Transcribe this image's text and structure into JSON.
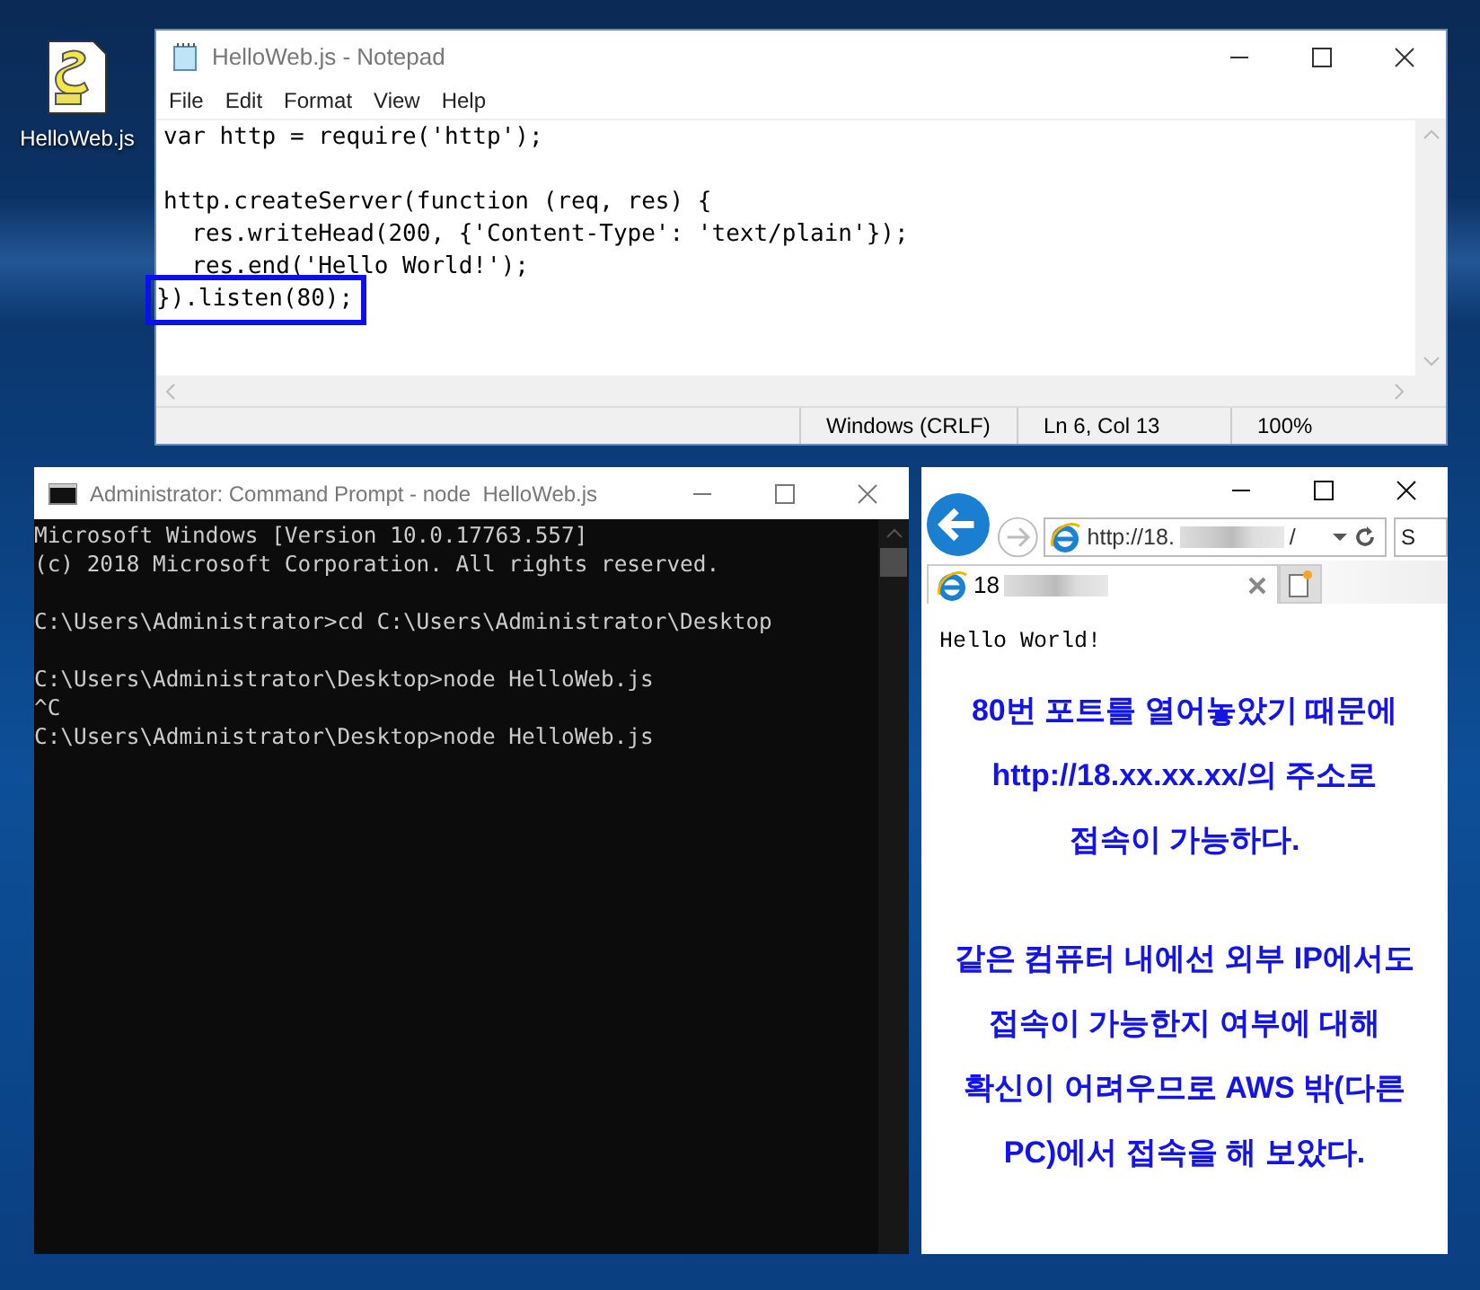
{
  "desktop_icon": {
    "label": "HelloWeb.js"
  },
  "notepad": {
    "title": "HelloWeb.js - Notepad",
    "menu": [
      "File",
      "Edit",
      "Format",
      "View",
      "Help"
    ],
    "blocks": [
      [
        {
          "text": "var http = require('http');",
          "boxed": false
        }
      ],
      [
        {
          "text": "http.createServer(function (req, res) {",
          "boxed": false
        },
        {
          "text": "  res.writeHead(200, {'Content-Type': 'text/plain'});",
          "boxed": false
        },
        {
          "text": "  res.end('Hello World!');",
          "boxed": false
        },
        {
          "text": "}).listen(80);",
          "boxed": true
        }
      ]
    ],
    "status": [
      "Windows (CRLF)",
      "Ln 6, Col 13",
      "100%"
    ]
  },
  "cmd": {
    "title": "Administrator: Command Prompt - node  HelloWeb.js",
    "blocks": [
      [
        "Microsoft Windows [Version 10.0.17763.557]",
        "(c) 2018 Microsoft Corporation. All rights reserved."
      ],
      [
        "C:\\Users\\Administrator>cd C:\\Users\\Administrator\\Desktop"
      ],
      [
        "C:\\Users\\Administrator\\Desktop>node HelloWeb.js",
        "^C",
        "C:\\Users\\Administrator\\Desktop>node HelloWeb.js"
      ]
    ]
  },
  "browser": {
    "address_prefix": "http://18.",
    "address_suffix": "/",
    "search_placeholder": "S",
    "tab_title": "18",
    "page_text": "Hello World!"
  },
  "annotation": {
    "paragraphs": [
      [
        "80번 포트를 열어놓았기 때문에",
        "http://18.xx.xx.xx/의 주소로",
        "접속이 가능하다."
      ],
      [
        "같은 컴퓨터 내에선 외부 IP에서도",
        "접속이 가능한지 여부에 대해",
        "확신이 어려우므로 AWS 밖(다른",
        "PC)에서 접속을 해 보았다."
      ]
    ]
  }
}
